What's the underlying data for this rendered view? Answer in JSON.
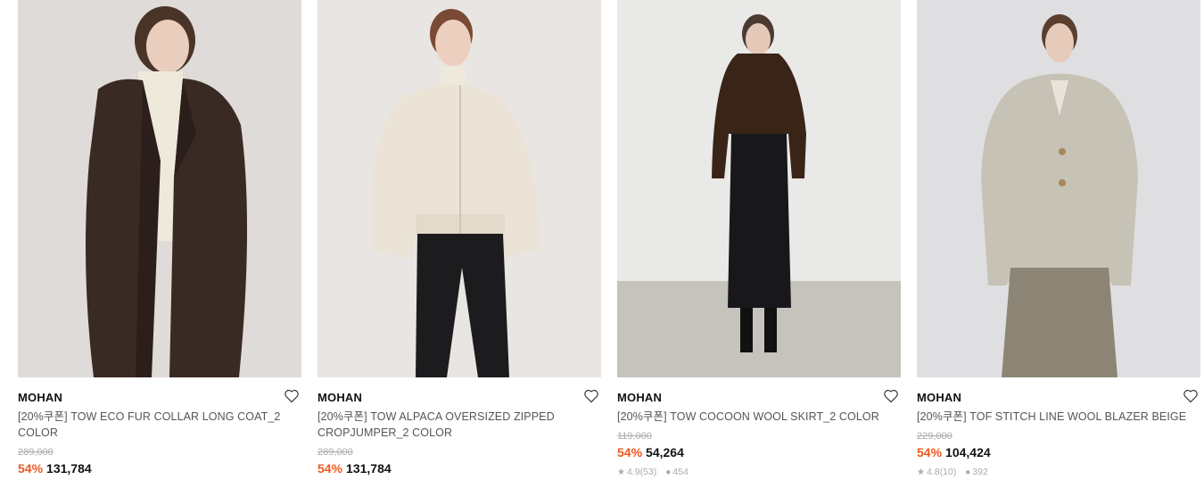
{
  "products": [
    {
      "brand": "MOHAN",
      "name": "[20%쿠폰] TOW ECO FUR COLLAR LONG COAT_2 COLOR",
      "original_price": "289,000",
      "discount": "54%",
      "price": "131,784"
    },
    {
      "brand": "MOHAN",
      "name": "[20%쿠폰] TOW ALPACA OVERSIZED ZIPPED CROPJUMPER_2 COLOR",
      "original_price": "289,000",
      "discount": "54%",
      "price": "131,784"
    },
    {
      "brand": "MOHAN",
      "name": "[20%쿠폰] TOW COCOON WOOL SKIRT_2 COLOR",
      "original_price": "119,000",
      "discount": "54%",
      "price": "54,264",
      "rating": "4.9(53)",
      "likes": "454"
    },
    {
      "brand": "MOHAN",
      "name": "[20%쿠폰] TOF STITCH LINE WOOL BLAZER BEIGE",
      "original_price": "229,000",
      "discount": "54%",
      "price": "104,424",
      "rating": "4.8(10)",
      "likes": "392"
    }
  ],
  "colors": {
    "discount": "#ef5a1e"
  },
  "icons": {
    "wishlist": "heart-outline-icon",
    "rating": "star-icon",
    "likes": "chat-icon"
  }
}
